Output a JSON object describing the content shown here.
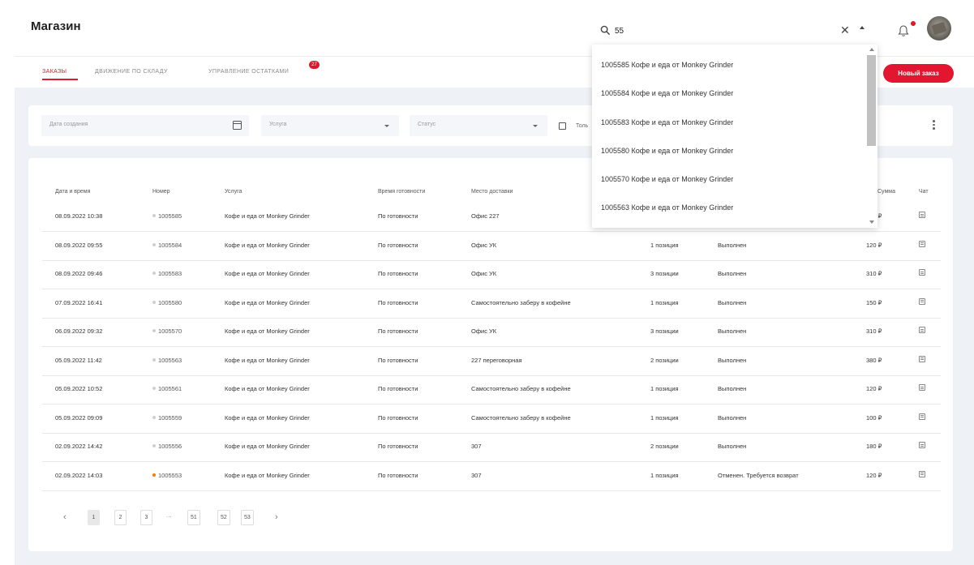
{
  "header": {
    "title": "Магазин",
    "search_value": "55"
  },
  "tabs": [
    {
      "label": "Заказы",
      "active": true
    },
    {
      "label": "Движение по складу",
      "active": false
    },
    {
      "label": "Управление остатками",
      "active": false
    }
  ],
  "tab_badge": "27",
  "new_order_label": "Новый заказ",
  "filters": {
    "date_placeholder": "Дата создания",
    "service_placeholder": "Услуга",
    "status_placeholder": "Статус",
    "checkbox_label": "Толь"
  },
  "table": {
    "headers": [
      "Дата и время",
      "Номер",
      "Услуга",
      "Время готовности",
      "Место доставки",
      "Сумма",
      "Чат"
    ],
    "rows": [
      {
        "date": "08.09.2022 10:38",
        "number": "1005585",
        "service": "Кофе и еда от Monkey Grinder",
        "ready": "По готовности",
        "place": "Офис 227",
        "qty": "",
        "status": "",
        "sum": "150 ₽",
        "dot": "gray"
      },
      {
        "date": "08.09.2022 09:55",
        "number": "1005584",
        "service": "Кофе и еда от Monkey Grinder",
        "ready": "По готовности",
        "place": "Офис УК",
        "qty": "1 позиция",
        "status": "Выполнен",
        "sum": "120 ₽",
        "dot": "gray"
      },
      {
        "date": "08.09.2022 09:46",
        "number": "1005583",
        "service": "Кофе и еда от Monkey Grinder",
        "ready": "По готовности",
        "place": "Офис УК",
        "qty": "3 позиции",
        "status": "Выполнен",
        "sum": "310 ₽",
        "dot": "gray"
      },
      {
        "date": "07.09.2022 16:41",
        "number": "1005580",
        "service": "Кофе и еда от Monkey Grinder",
        "ready": "По готовности",
        "place": "Самостоятельно заберу в кофейне",
        "qty": "1 позиция",
        "status": "Выполнен",
        "sum": "150 ₽",
        "dot": "gray"
      },
      {
        "date": "06.09.2022 09:32",
        "number": "1005570",
        "service": "Кофе и еда от Monkey Grinder",
        "ready": "По готовности",
        "place": "Офис УК",
        "qty": "3 позиции",
        "status": "Выполнен",
        "sum": "310 ₽",
        "dot": "gray"
      },
      {
        "date": "05.09.2022 11:42",
        "number": "1005563",
        "service": "Кофе и еда от Monkey Grinder",
        "ready": "По готовности",
        "place": "227 переговорная",
        "qty": "2 позиции",
        "status": "Выполнен",
        "sum": "380 ₽",
        "dot": "gray"
      },
      {
        "date": "05.09.2022 10:52",
        "number": "1005561",
        "service": "Кофе и еда от Monkey Grinder",
        "ready": "По готовности",
        "place": "Самостоятельно заберу в кофейне",
        "qty": "1 позиция",
        "status": "Выполнен",
        "sum": "120 ₽",
        "dot": "gray"
      },
      {
        "date": "05.09.2022 09:09",
        "number": "1005559",
        "service": "Кофе и еда от Monkey Grinder",
        "ready": "По готовности",
        "place": "Самостоятельно заберу в кофейне",
        "qty": "1 позиция",
        "status": "Выполнен",
        "sum": "100 ₽",
        "dot": "gray"
      },
      {
        "date": "02.09.2022 14:42",
        "number": "1005556",
        "service": "Кофе и еда от Monkey Grinder",
        "ready": "По готовности",
        "place": "307",
        "qty": "2 позиции",
        "status": "Выполнен",
        "sum": "180 ₽",
        "dot": "gray"
      },
      {
        "date": "02.09.2022 14:03",
        "number": "1005553",
        "service": "Кофе и еда от Monkey Grinder",
        "ready": "По готовности",
        "place": "307",
        "qty": "1 позиция",
        "status": "Отменен. Требуется возврат",
        "sum": "120 ₽",
        "dot": "orange"
      }
    ]
  },
  "pagination": {
    "prev": "‹",
    "pages": [
      "1",
      "2",
      "3",
      "51",
      "52",
      "53"
    ],
    "ellipsis": "...",
    "next": "›",
    "active": "1"
  },
  "dropdown": {
    "items": [
      "1005585 Кофе и еда от Monkey Grinder",
      "1005584 Кофе и еда от Monkey Grinder",
      "1005583 Кофе и еда от Monkey Grinder",
      "1005580 Кофе и еда от Monkey Grinder",
      "1005570 Кофе и еда от Monkey Grinder",
      "1005563 Кофе и еда от Monkey Grinder"
    ]
  },
  "colors": {
    "accent": "#e21630",
    "background": "#eef1f6",
    "warning_dot": "#ff7a00"
  }
}
